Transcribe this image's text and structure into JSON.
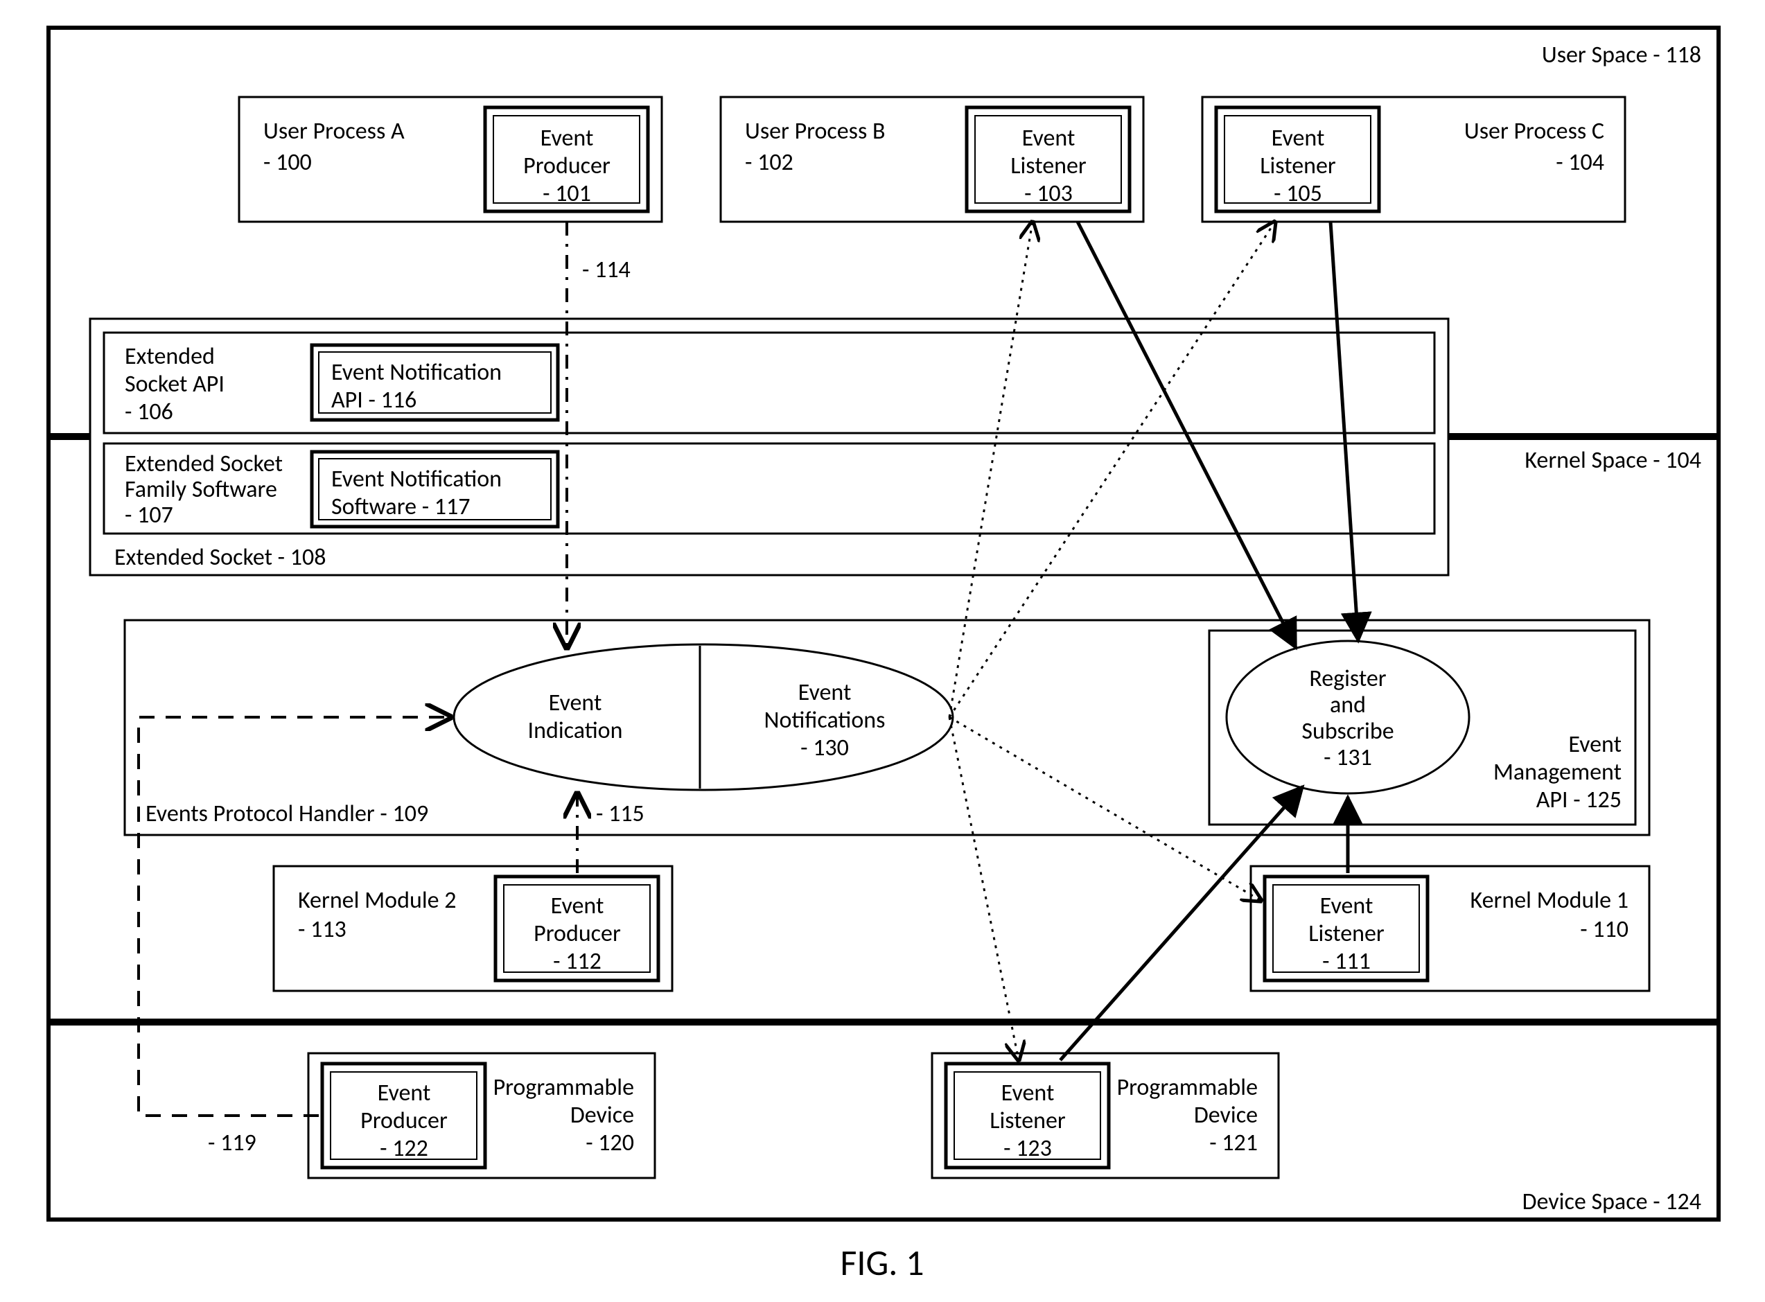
{
  "figure_caption": "FIG. 1",
  "spaces": {
    "user_space": "User Space - 118",
    "kernel_space": "Kernel Space - 104",
    "device_space": "Device Space - 124"
  },
  "user_processes": {
    "a": {
      "title": "User Process A",
      "ref": "- 100",
      "sub": {
        "title": "Event",
        "title2": "Producer",
        "ref": "- 101"
      }
    },
    "b": {
      "title": "User Process B",
      "ref": "- 102",
      "sub": {
        "title": "Event",
        "title2": "Listener",
        "ref": "- 103"
      }
    },
    "c": {
      "title": "User Process C",
      "ref": "- 104",
      "sub": {
        "title": "Event",
        "title2": "Listener",
        "ref": "- 105"
      }
    }
  },
  "extended_socket": {
    "outer": "Extended Socket  - 108",
    "api": {
      "l1": "Extended",
      "l2": "Socket API",
      "ref": "- 106",
      "sub": {
        "title": "Event Notification",
        "title2": "API - 116"
      }
    },
    "sw": {
      "l1": "Extended Socket",
      "l2": "Family Software",
      "ref": "- 107",
      "sub": {
        "title": "Event Notification",
        "title2": "Software - 117"
      }
    }
  },
  "handler": {
    "title": "Events Protocol Handler - 109",
    "ev_ind": {
      "l1": "Event",
      "l2": "Indication"
    },
    "ev_not": {
      "l1": "Event",
      "l2": "Notifications",
      "ref": "- 130"
    },
    "reg": {
      "l1": "Register",
      "l2": "and",
      "l3": "Subscribe",
      "ref": "- 131"
    },
    "mgmt": {
      "l1": "Event",
      "l2": "Management",
      "l3": "API - 125"
    }
  },
  "kernel_modules": {
    "m2": {
      "title": "Kernel Module 2",
      "ref": "- 113",
      "sub": {
        "title": "Event",
        "title2": "Producer",
        "ref": "- 112"
      }
    },
    "m1": {
      "title": "Kernel Module 1",
      "ref": "- 110",
      "sub": {
        "title": "Event",
        "title2": "Listener",
        "ref": "- 111"
      }
    }
  },
  "devices": {
    "d0": {
      "l1": "Programmable",
      "l2": "Device",
      "ref": "- 120",
      "sub": {
        "title": "Event",
        "title2": "Producer",
        "ref": "- 122"
      }
    },
    "d1": {
      "l1": "Programmable",
      "l2": "Device",
      "ref": "- 121",
      "sub": {
        "title": "Event",
        "title2": "Listener",
        "ref": "- 123"
      }
    }
  },
  "arrows": {
    "114": "- 114",
    "115": "- 115",
    "119": "- 119"
  }
}
